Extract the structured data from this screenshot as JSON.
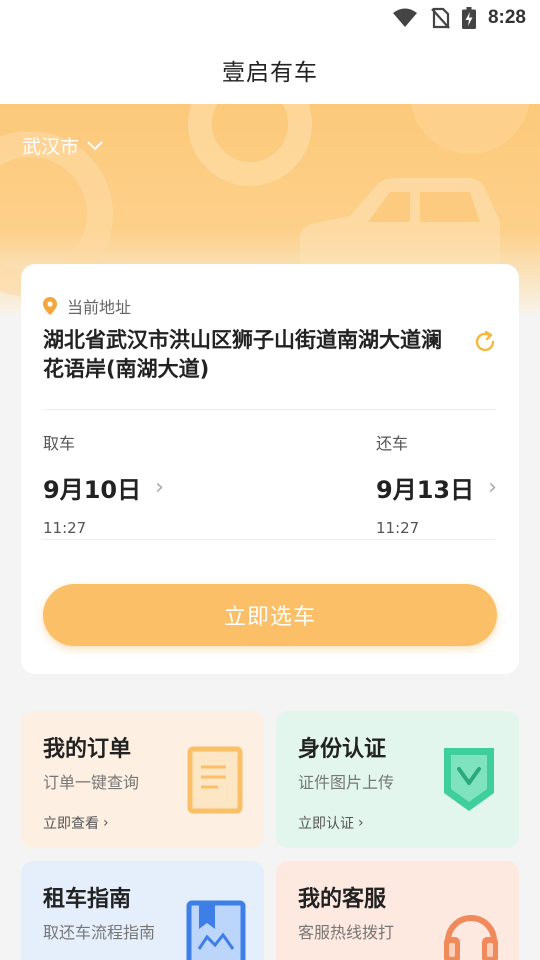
{
  "status_bar": {
    "time": "8:28",
    "icons": [
      "wifi-icon",
      "no-sim-icon",
      "battery-charging-icon"
    ]
  },
  "app": {
    "title": "壹启有车"
  },
  "hero": {
    "city": "武汉市",
    "city_icon": "chevron-down-icon"
  },
  "location": {
    "label": "当前地址",
    "address": "湖北省武汉市洪山区狮子山街道南湖大道澜花语岸(南湖大道)",
    "icon": "location-pin-icon",
    "refresh_icon": "refresh-icon"
  },
  "pickup": {
    "label": "取车",
    "date": "9月10日",
    "time": "11:27"
  },
  "dropoff": {
    "label": "还车",
    "date": "9月13日",
    "time": "11:27"
  },
  "cta": {
    "label": "立即选车"
  },
  "tiles": [
    {
      "title": "我的订单",
      "subtitle": "订单一键查询",
      "link": "立即查看",
      "icon": "document-icon",
      "bg": "#fdf0e2"
    },
    {
      "title": "身份认证",
      "subtitle": "证件图片上传",
      "link": "立即认证",
      "icon": "shield-check-icon",
      "bg": "#e2f6ee"
    },
    {
      "title": "租车指南",
      "subtitle": "取还车流程指南",
      "icon": "guide-book-icon",
      "bg": "#e5effc"
    },
    {
      "title": "我的客服",
      "subtitle": "客服热线拨打",
      "icon": "headset-icon",
      "bg": "#fde9df"
    }
  ],
  "colors": {
    "accent": "#fbc067",
    "hero": "#fcc97a",
    "text": "#222222"
  }
}
